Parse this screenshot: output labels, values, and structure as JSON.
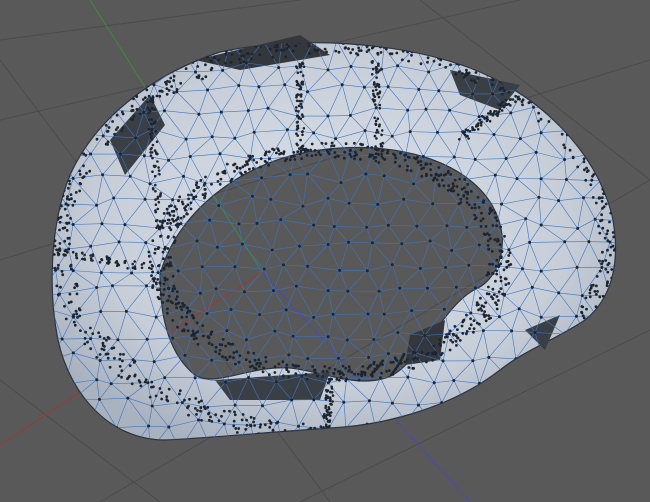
{
  "viewport": {
    "background": "#595959",
    "grid_color": "#4b4b4b",
    "axis_colors": {
      "x": "#9a3a35",
      "y": "#3f8a3a",
      "z": "#4a4ab5"
    },
    "mesh": {
      "fill": "#c9cfd8",
      "fill_shade": "#a9b2bf",
      "dark_face": "#34383d",
      "wire": "#3d74c4",
      "vertex": "#1c2530",
      "vertex_density": "high"
    }
  }
}
